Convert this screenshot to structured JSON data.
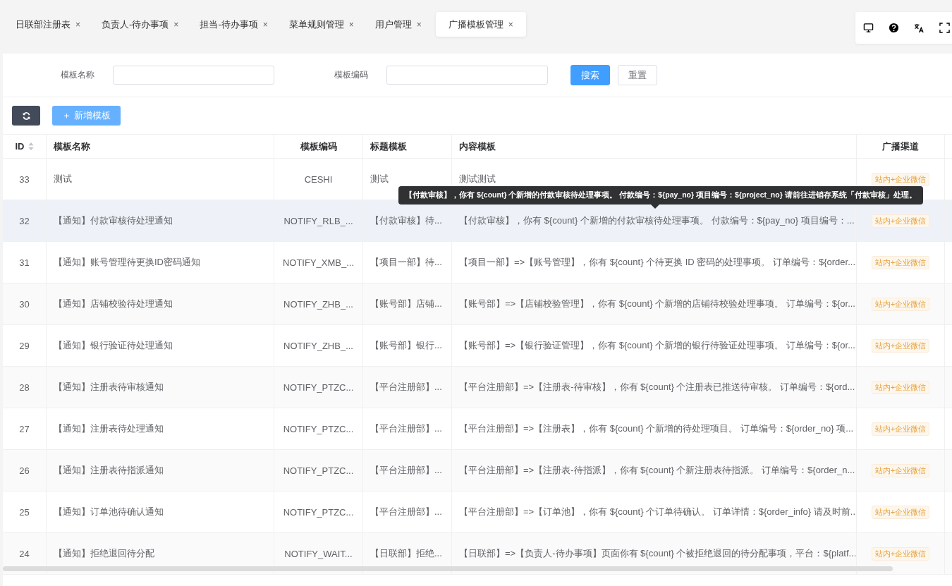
{
  "tabs": [
    {
      "label": "日联部注册表",
      "selected": false
    },
    {
      "label": "负责人-待办事项",
      "selected": false
    },
    {
      "label": "担当-待办事项",
      "selected": false
    },
    {
      "label": "菜单规则管理",
      "selected": false
    },
    {
      "label": "用户管理",
      "selected": false
    },
    {
      "label": "广播模板管理",
      "selected": true
    }
  ],
  "tab_close": "×",
  "search_form": {
    "fields": [
      {
        "label": "模板名称"
      },
      {
        "label": "模板编码"
      }
    ],
    "buttons": [
      {
        "label": "搜索",
        "kind": "primary"
      },
      {
        "label": "重置",
        "kind": "plain"
      }
    ]
  },
  "toolbar": {
    "add_button": "＋ 新增模板"
  },
  "table": {
    "columns": [
      {
        "label": "ID",
        "sortable": true
      },
      {
        "label": "模板名称",
        "sortable": false
      },
      {
        "label": "模板编码",
        "sortable": false
      },
      {
        "label": "标题模板",
        "sortable": false
      },
      {
        "label": "内容模板",
        "sortable": false
      },
      {
        "label": "广播渠道",
        "sortable": false
      }
    ],
    "rows": [
      {
        "id": "33",
        "name": "测试",
        "code": "CESHI",
        "title": "测试",
        "content": "测试测试",
        "channel": "站内+企业微信",
        "highlighted": false
      },
      {
        "id": "32",
        "name": "【通知】付款审核待处理通知",
        "code": "NOTIFY_RLB_...",
        "title": "【付款审核】待...",
        "content": "【付款审核】，你有 ${count} 个新增的付款审核待处理事项。 付款编号：${pay_no} 项目编号：...",
        "channel": "站内+企业微信",
        "highlighted": true
      },
      {
        "id": "31",
        "name": "【通知】账号管理待更换ID密码通知",
        "code": "NOTIFY_XMB_...",
        "title": "【项目一部】待...",
        "content": "【项目一部】=>【账号管理】，你有 ${count} 个待更换 ID 密码的处理事项。 订单编号：${order...",
        "channel": "站内+企业微信",
        "highlighted": false
      },
      {
        "id": "30",
        "name": "【通知】店铺校验待处理通知",
        "code": "NOTIFY_ZHB_...",
        "title": "【账号部】店铺...",
        "content": "【账号部】=>【店铺校验管理】，你有 ${count} 个新增的店铺待校验处理事项。 订单编号：${or...",
        "channel": "站内+企业微信",
        "highlighted": false
      },
      {
        "id": "29",
        "name": "【通知】银行验证待处理通知",
        "code": "NOTIFY_ZHB_...",
        "title": "【账号部】银行...",
        "content": "【账号部】=>【银行验证管理】，你有 ${count} 个新增的银行待验证处理事项。 订单编号：${or...",
        "channel": "站内+企业微信",
        "highlighted": false
      },
      {
        "id": "28",
        "name": "【通知】注册表待审核通知",
        "code": "NOTIFY_PTZC...",
        "title": "【平台注册部】...",
        "content": "【平台注册部】=>【注册表-待审核】，你有 ${count} 个注册表已推送待审核。 订单编号：${ord...",
        "channel": "站内+企业微信",
        "highlighted": false
      },
      {
        "id": "27",
        "name": "【通知】注册表待处理通知",
        "code": "NOTIFY_PTZC...",
        "title": "【平台注册部】...",
        "content": "【平台注册部】=>【注册表】，你有 ${count} 个新增的待处理项目。 订单编号：${order_no} 项...",
        "channel": "站内+企业微信",
        "highlighted": false
      },
      {
        "id": "26",
        "name": "【通知】注册表待指派通知",
        "code": "NOTIFY_PTZC...",
        "title": "【平台注册部】...",
        "content": "【平台注册部】=>【注册表-待指派】，你有 ${count} 个新注册表待指派。 订单编号：${order_n...",
        "channel": "站内+企业微信",
        "highlighted": false
      },
      {
        "id": "25",
        "name": "【通知】订单池待确认通知",
        "code": "NOTIFY_PTZC...",
        "title": "【平台注册部】...",
        "content": "【平台注册部】=>【订单池】，你有 ${count} 个订单待确认。 订单详情：${order_info} 请及时前...",
        "channel": "站内+企业微信",
        "highlighted": false
      },
      {
        "id": "24",
        "name": "【通知】拒绝退回待分配",
        "code": "NOTIFY_WAIT...",
        "title": "【日联部】拒绝...",
        "content": "【日联部】=>【负责人-待办事项】页面你有 ${count} 个被拒绝退回的待分配事项，平台：${platf...",
        "channel": "站内+企业微信",
        "highlighted": false
      }
    ]
  },
  "tooltip": {
    "text": "【付款审核】，你有 ${count} 个新增的付款审核待处理事项。 付款编号：${pay_no} 项目编号：${project_no} 请前往进销存系统「付款审核」处理。"
  }
}
